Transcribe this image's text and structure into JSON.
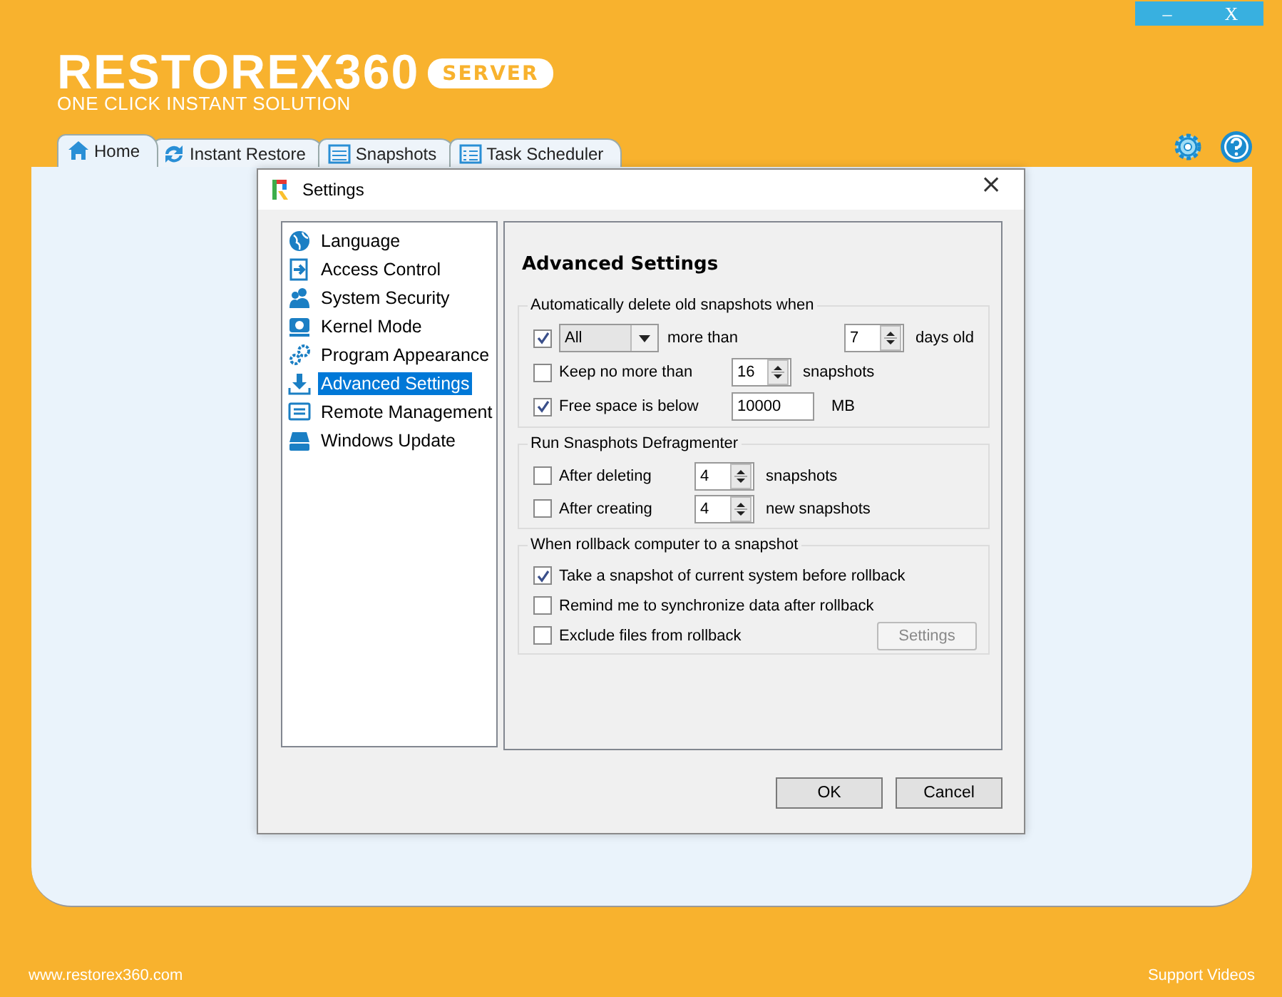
{
  "window_controls": [
    {
      "label": "–"
    },
    {
      "label": "X"
    }
  ],
  "brand": {
    "name": "RESTOREX360",
    "badge": "SERVER",
    "tagline": "ONE CLICK INSTANT SOLUTION"
  },
  "tabs": [
    {
      "label": "Home",
      "selected": true
    },
    {
      "label": "Instant Restore",
      "selected": false
    },
    {
      "label": "Snapshots",
      "selected": false
    },
    {
      "label": "Task Scheduler",
      "selected": false
    }
  ],
  "dialog": {
    "title": "Settings",
    "close": "×",
    "categories": [
      {
        "label": "Language",
        "selected": false
      },
      {
        "label": "Access Control",
        "selected": false
      },
      {
        "label": "System Security",
        "selected": false
      },
      {
        "label": "Kernel Mode",
        "selected": false
      },
      {
        "label": "Program Appearance",
        "selected": false
      },
      {
        "label": "Advanced Settings",
        "selected": true
      },
      {
        "label": "Remote Management",
        "selected": false
      },
      {
        "label": "Windows Update",
        "selected": false
      }
    ],
    "page_title": "Advanced Settings",
    "groups": [
      {
        "legend": "Automatically delete old snapshots when",
        "rows": [
          {
            "kind": "combo",
            "checked": true,
            "dropdown": "All",
            "label": "more than",
            "spin": "7",
            "unit": "days old"
          },
          {
            "kind": "spin",
            "checked": false,
            "label": "Keep no more than",
            "spin": "16",
            "unit": "snapshots"
          },
          {
            "kind": "field",
            "checked": true,
            "label": "Free space is below",
            "field": "10000",
            "unit": "MB"
          }
        ]
      },
      {
        "legend": "Run Snasphots Defragmenter",
        "rows": [
          {
            "kind": "spin",
            "checked": false,
            "label": "After deleting",
            "spin": "4",
            "unit": "snapshots"
          },
          {
            "kind": "spin",
            "checked": false,
            "label": "After creating",
            "spin": "4",
            "unit": "new snapshots"
          }
        ]
      },
      {
        "legend": "When rollback computer to a snapshot",
        "rows": [
          {
            "kind": "check",
            "checked": true,
            "label": "Take a snapshot of current system before rollback"
          },
          {
            "kind": "check",
            "checked": false,
            "label": "Remind me to synchronize data after rollback"
          },
          {
            "kind": "button",
            "checked": false,
            "label": "Exclude files from rollback",
            "button": {
              "label": "Settings",
              "disabled": true
            }
          }
        ]
      }
    ],
    "buttons": [
      {
        "label": "OK"
      },
      {
        "label": "Cancel"
      }
    ]
  },
  "footer": {
    "link": "www.restorex360.com",
    "support": "Support Videos"
  }
}
